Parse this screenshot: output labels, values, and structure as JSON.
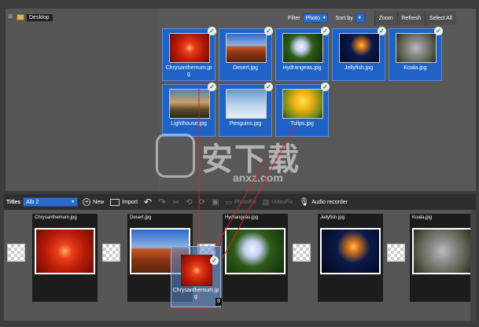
{
  "folder_tree": {
    "root_label": "Desktop"
  },
  "toolbar": {
    "filter_label": "Filter",
    "filter_value": "Photo",
    "sort_label": "Sort by",
    "zoom": "Zoom",
    "refresh": "Refresh",
    "select_all": "Select All"
  },
  "photos": [
    {
      "name": "Chrysanthemum.jpg",
      "caption_line1": "Chrysanthemum.jp",
      "caption_line2": "g"
    },
    {
      "name": "Desert.jpg"
    },
    {
      "name": "Hydrangeas.jpg"
    },
    {
      "name": "Jellyfish.jpg"
    },
    {
      "name": "Koala.jpg"
    },
    {
      "name": "Lighthouse.jpg"
    },
    {
      "name": "Penguins.jpg"
    },
    {
      "name": "Tulips.jpg"
    }
  ],
  "slide_bar": {
    "titles_label": "Titles",
    "album_value": "Alb 2",
    "new": "New",
    "import": "Import",
    "photofix": "PhotoFix",
    "videofix": "VideoFix",
    "audio_recorder": "Audio recorder"
  },
  "slides": [
    {
      "name": "Chrysanthemum.jpg"
    },
    {
      "name": "Desert.jpg"
    },
    {
      "name": "Hydrangeas.jpg"
    },
    {
      "name": "Jellyfish.jpg"
    },
    {
      "name": "Koala.jpg"
    }
  ],
  "drag_item": {
    "caption_line1": "Chrysanthemum.jp",
    "caption_line2": "g",
    "badge": "8"
  },
  "watermark": {
    "text": "安下载",
    "sub": "anxz.com"
  },
  "colors": {
    "selection": "#1f62c4",
    "dropdown": "#2c6cc6",
    "check": "#2a7a2a"
  }
}
